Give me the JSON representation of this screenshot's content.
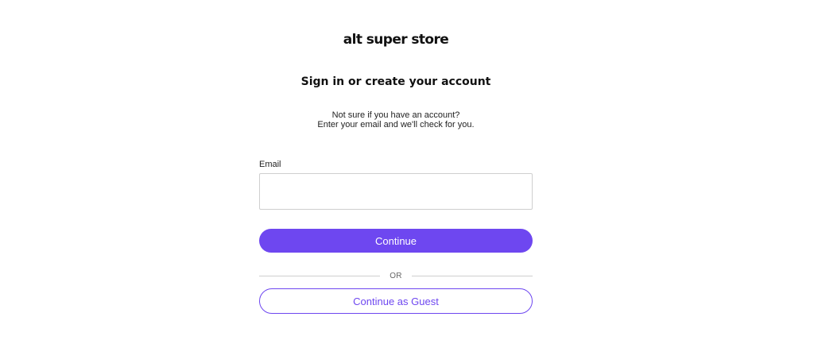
{
  "brand": {
    "logo_text": "alt super store"
  },
  "heading": {
    "title": "Sign in or create your account",
    "subtitle_line1": "Not sure if you have an account?",
    "subtitle_line2": "Enter your email and we'll check for you."
  },
  "form": {
    "email_label": "Email",
    "email_value": "",
    "continue_label": "Continue",
    "divider_text": "OR",
    "guest_label": "Continue as Guest"
  },
  "colors": {
    "accent": "#6e47f0",
    "input_border": "#cfcfcf",
    "text": "#111111"
  }
}
